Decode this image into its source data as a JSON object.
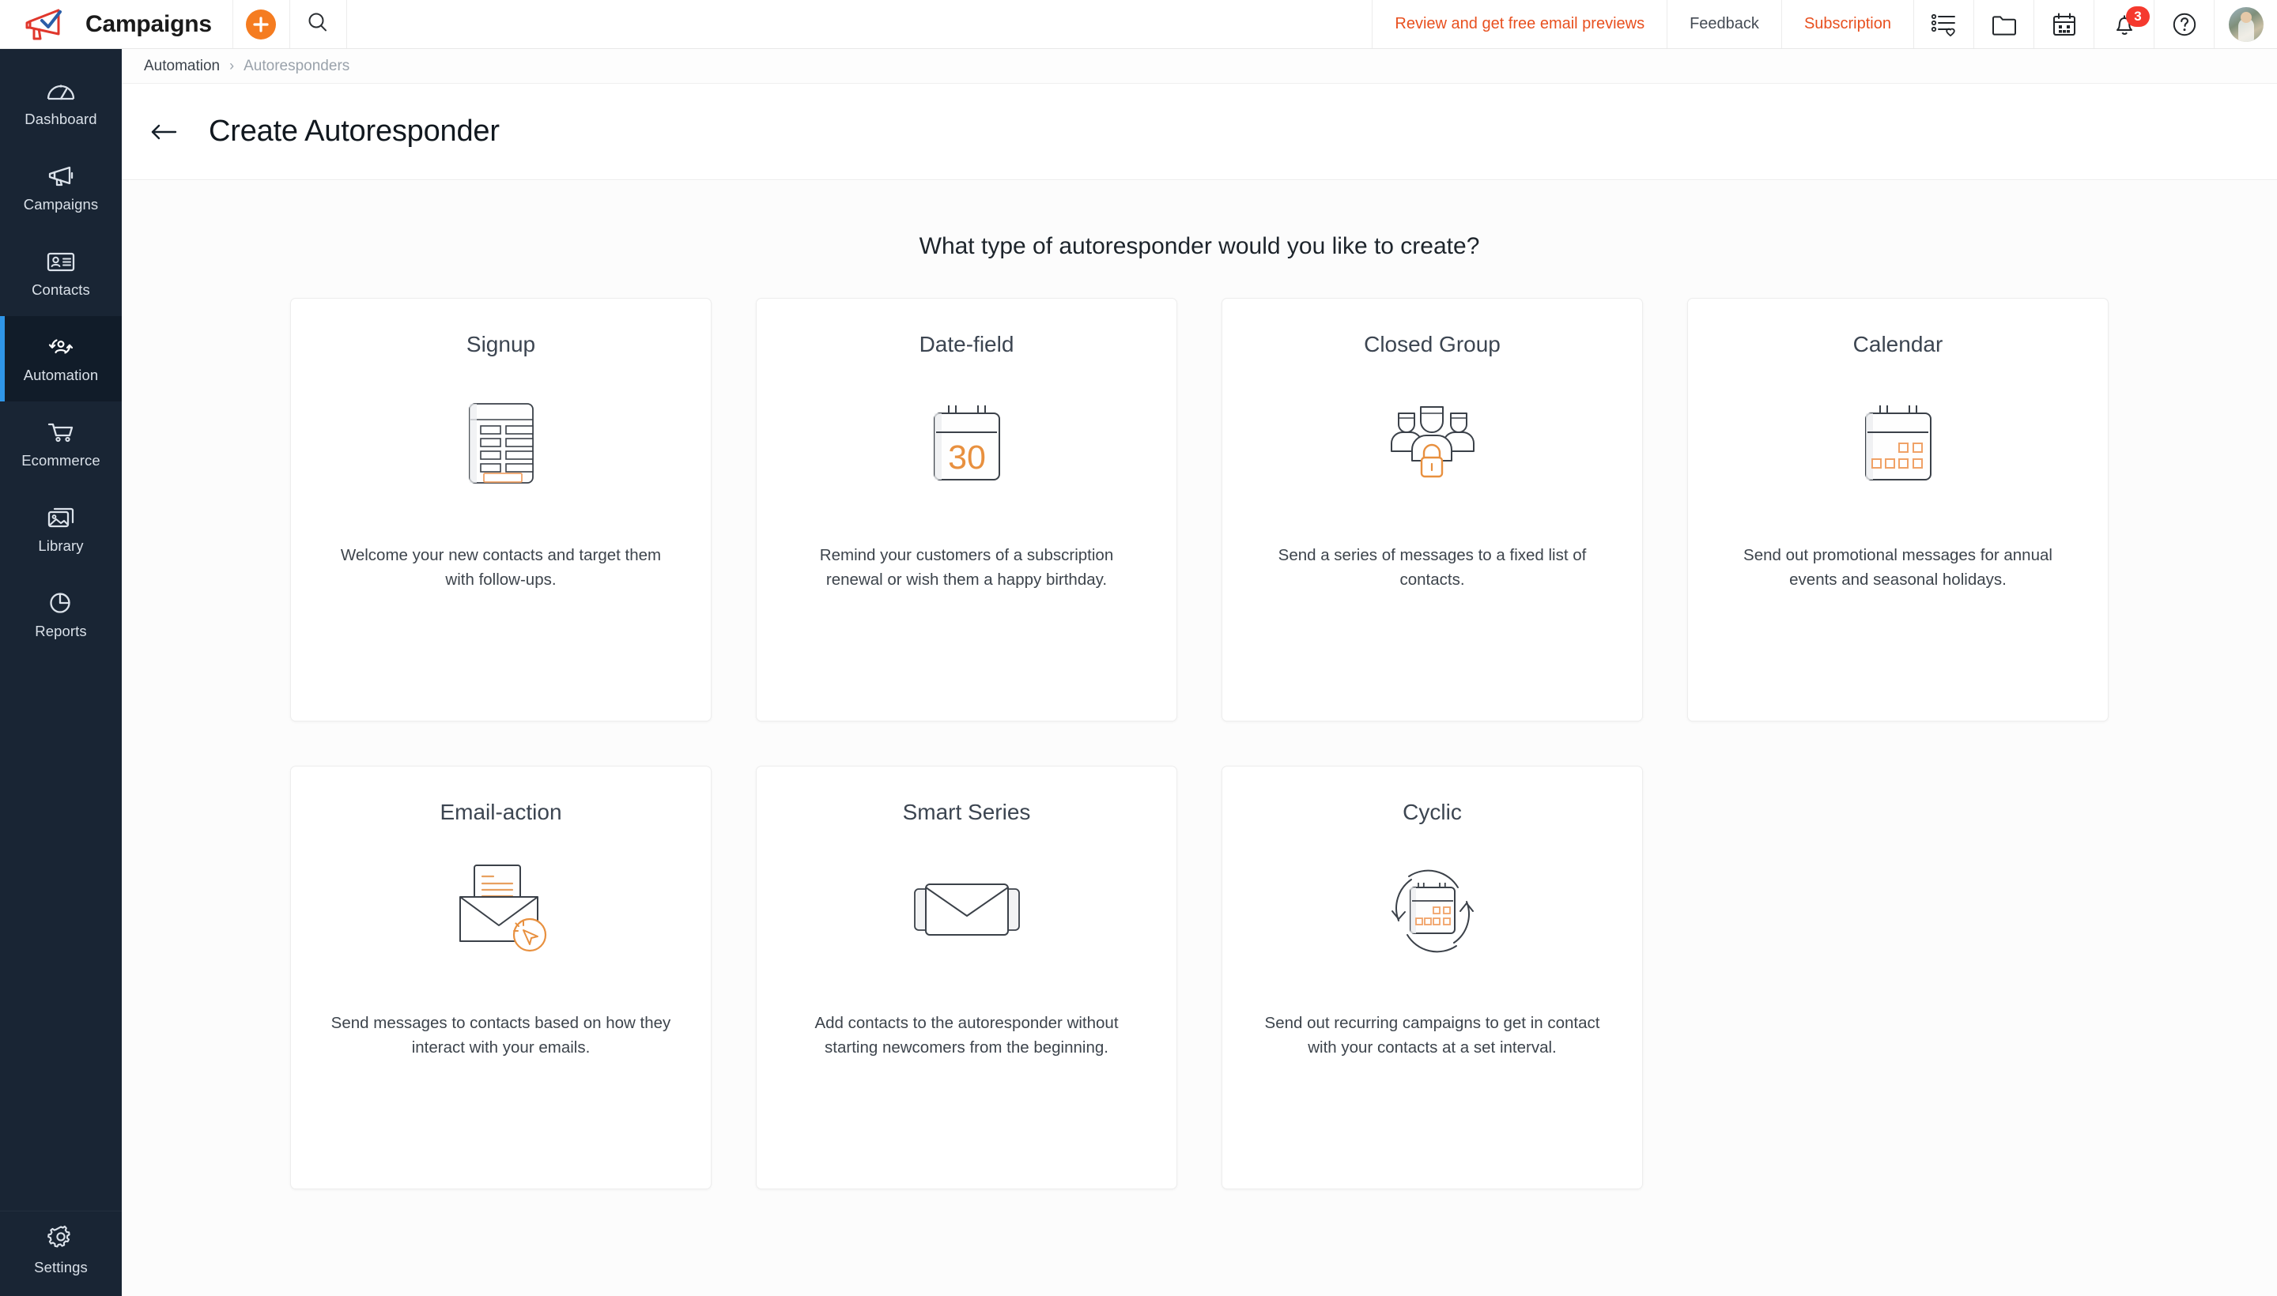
{
  "header": {
    "logo_icon": "megaphone-check-logo",
    "brand": "Campaigns",
    "add_button_icon": "plus-icon",
    "search_icon": "search-icon",
    "links": [
      {
        "label": "Review and get free email previews",
        "style": "accent",
        "name": "review-email-previews-link"
      },
      {
        "label": "Feedback",
        "style": "neutral",
        "name": "feedback-link"
      },
      {
        "label": "Subscription",
        "style": "accent",
        "name": "subscription-link"
      }
    ],
    "icons": [
      {
        "name": "list-heart-icon"
      },
      {
        "name": "folder-icon"
      },
      {
        "name": "calendar-icon"
      },
      {
        "name": "bell-icon",
        "badge": "3"
      },
      {
        "name": "help-icon"
      }
    ],
    "avatar_name": "user-avatar"
  },
  "sidebar": {
    "items": [
      {
        "label": "Dashboard",
        "icon": "dashboard-gauge-icon",
        "active": false
      },
      {
        "label": "Campaigns",
        "icon": "megaphone-icon",
        "active": false
      },
      {
        "label": "Contacts",
        "icon": "contact-card-icon",
        "active": false
      },
      {
        "label": "Automation",
        "icon": "automation-cycle-icon",
        "active": true
      },
      {
        "label": "Ecommerce",
        "icon": "shopping-cart-icon",
        "active": false
      },
      {
        "label": "Library",
        "icon": "image-library-icon",
        "active": false
      },
      {
        "label": "Reports",
        "icon": "pie-chart-icon",
        "active": false
      }
    ],
    "settings": {
      "label": "Settings",
      "icon": "gear-icon"
    }
  },
  "breadcrumb": {
    "parent": "Automation",
    "separator": "›",
    "current": "Autoresponders"
  },
  "page": {
    "back_icon": "arrow-left-icon",
    "title": "Create Autoresponder",
    "question": "What type of autoresponder would you like to create?"
  },
  "cards": [
    {
      "title": "Signup",
      "icon": "signup-form-icon",
      "description": "Welcome your new contacts and target them with follow-ups."
    },
    {
      "title": "Date-field",
      "icon": "calendar-date-30-icon",
      "icon_value": "30",
      "description": "Remind your customers of a subscription renewal or wish them a happy birthday."
    },
    {
      "title": "Closed Group",
      "icon": "group-lock-icon",
      "description": "Send a series of messages to a fixed list of contacts."
    },
    {
      "title": "Calendar",
      "icon": "calendar-events-icon",
      "description": "Send out promotional messages for annual events and seasonal holidays."
    },
    {
      "title": "Email-action",
      "icon": "envelope-click-icon",
      "description": "Send messages to contacts based on how they interact with your emails."
    },
    {
      "title": "Smart Series",
      "icon": "stacked-envelopes-icon",
      "description": "Add contacts to the autoresponder without starting newcomers from the beginning."
    },
    {
      "title": "Cyclic",
      "icon": "calendar-recurring-icon",
      "description": "Send out recurring campaigns to get in contact with your contacts at a set interval."
    }
  ],
  "colors": {
    "accent_orange": "#f57c20",
    "link_orange": "#e8501f",
    "sidebar_bg": "#192534",
    "sidebar_active_bar": "#2f96e8",
    "badge_red": "#f5392e"
  }
}
